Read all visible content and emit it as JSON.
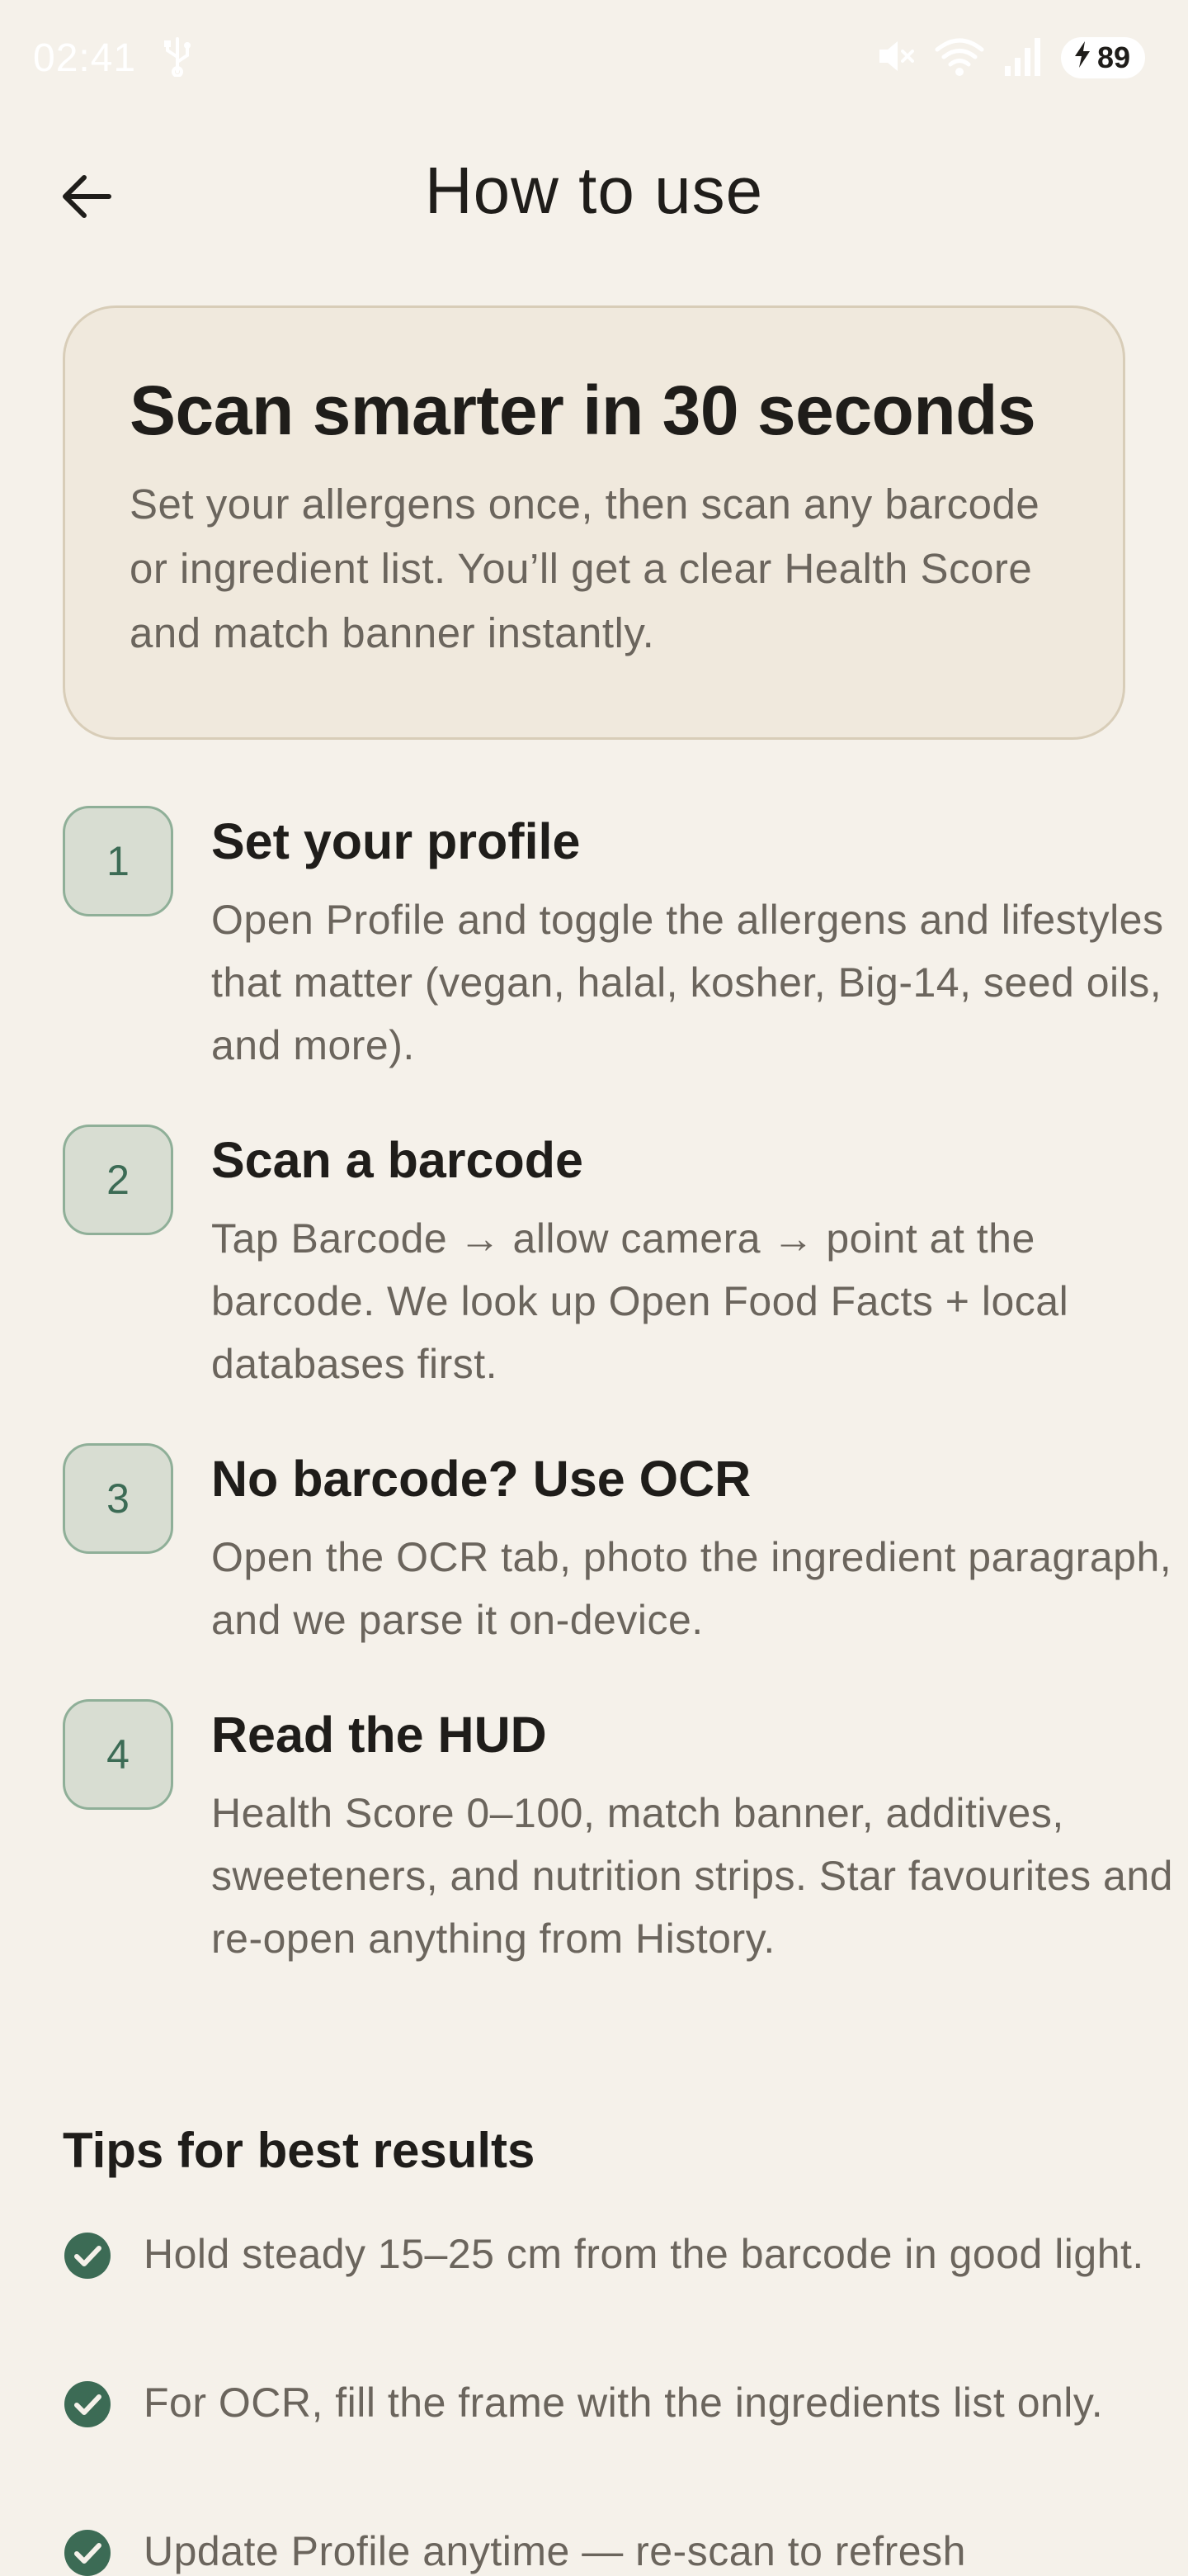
{
  "status_bar": {
    "time": "02:41",
    "battery_level": "89",
    "icons": [
      "usb-icon",
      "mute-icon",
      "wifi-icon",
      "signal-icon",
      "battery-charging-icon"
    ]
  },
  "app_bar": {
    "title": "How to use",
    "back_icon": "arrow-left-icon"
  },
  "hero": {
    "title": "Scan smarter in 30 seconds",
    "text": "Set your allergens once, then scan any barcode or ingredient list. You’ll get a clear Health Score and match banner instantly."
  },
  "steps": [
    {
      "number": "1",
      "title": "Set your profile",
      "body": "Open Profile and toggle the allergens and lifestyles that matter (vegan, halal, kosher, Big-14, seed oils, and more)."
    },
    {
      "number": "2",
      "title": "Scan a barcode",
      "body": "Tap Barcode → allow camera → point at the barcode. We look up Open Food Facts + local databases first."
    },
    {
      "number": "3",
      "title": "No barcode? Use OCR",
      "body": "Open the OCR tab, photo the ingredient paragraph, and we parse it on-device."
    },
    {
      "number": "4",
      "title": "Read the HUD",
      "body": "Health Score 0–100, match banner, additives, sweeteners, and nutrition strips. Star favourites and re-open anything from History."
    }
  ],
  "tips": {
    "heading": "Tips for best results",
    "icon": "check-circle-icon",
    "items": [
      "Hold steady 15–25 cm from the barcode in good light.",
      "For OCR, fill the frame with the ingredients list only.",
      "Update Profile anytime — re-scan to refresh"
    ]
  },
  "colors": {
    "background": "#f5f1ea",
    "hero_background": "#f0e9dd",
    "accent_green": "#3c6b55",
    "badge_background": "#d8ddd2",
    "text_primary": "#1f1d1a",
    "text_secondary": "#6b655d"
  }
}
